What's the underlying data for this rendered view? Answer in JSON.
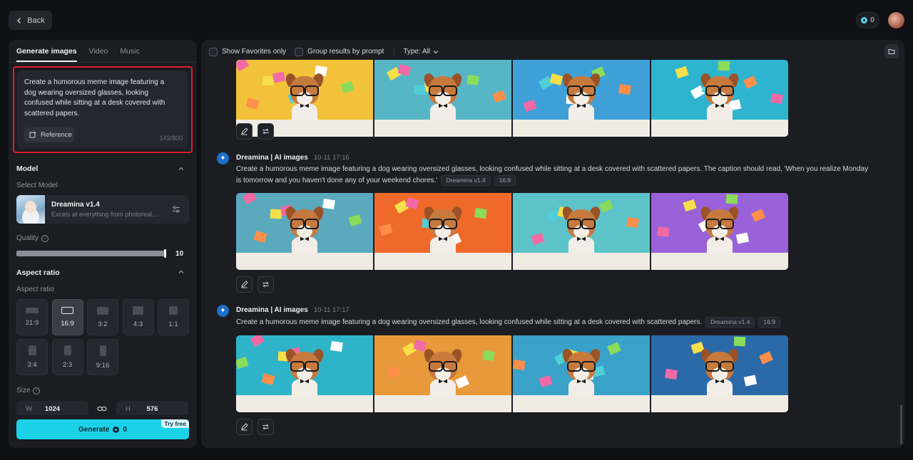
{
  "topbar": {
    "back_label": "Back",
    "credits": "0"
  },
  "left": {
    "tabs": [
      {
        "label": "Generate images",
        "active": true
      },
      {
        "label": "Video",
        "active": false
      },
      {
        "label": "Music",
        "active": false
      }
    ],
    "prompt": "Create a humorous meme image featuring a dog wearing oversized glasses, looking confused while sitting at a desk covered with scattered papers.",
    "reference_label": "Reference",
    "char_count": "143/800",
    "model": {
      "section_title": "Model",
      "select_label": "Select Model",
      "name": "Dreamina v1.4",
      "description": "Excels at everything from photorealism to painterly styles"
    },
    "quality": {
      "label": "Quality",
      "value": 10,
      "max": 10,
      "display": "10"
    },
    "aspect": {
      "section_title": "Aspect ratio",
      "sub_label": "Aspect ratio",
      "options": [
        {
          "label": "21:9",
          "active": false
        },
        {
          "label": "16:9",
          "active": true
        },
        {
          "label": "3:2",
          "active": false
        },
        {
          "label": "4:3",
          "active": false
        },
        {
          "label": "1:1",
          "active": false
        },
        {
          "label": "3:4",
          "active": false
        },
        {
          "label": "2:3",
          "active": false
        },
        {
          "label": "9:16",
          "active": false
        }
      ]
    },
    "size": {
      "label": "Size",
      "w_label": "W",
      "w_value": "1024",
      "h_label": "H",
      "h_value": "576"
    },
    "generate": {
      "label": "Generate",
      "cost": "0",
      "badge": "Try free"
    }
  },
  "right": {
    "filters": {
      "favorites": "Show Favorites only",
      "group": "Group results by prompt",
      "type": "Type: All"
    },
    "generations": [
      {
        "source": "",
        "time": "",
        "prompt": "",
        "tags": [],
        "palette": [
          "#f2c23a",
          "#57b6c6",
          "#3fa0d8",
          "#2fb4d0"
        ]
      },
      {
        "source": "Dreamina | AI images",
        "time": "10-11 17:16",
        "prompt": "Create a humorous meme image featuring a dog wearing oversized glasses, looking confused while sitting at a desk covered with scattered papers. The caption should read, 'When you realize Monday is tomorrow and you haven't done any of your weekend chores.'",
        "tags": [
          "Dreamina v1.4",
          "16:9"
        ],
        "palette": [
          "#5aa9bd",
          "#ef6a2a",
          "#5cc4c9",
          "#9a62d8"
        ]
      },
      {
        "source": "Dreamina | AI images",
        "time": "10-11 17:17",
        "prompt": "Create a humorous meme image featuring a dog wearing oversized glasses, looking confused while sitting at a desk covered with scattered papers.",
        "tags": [
          "Dreamina v1.4",
          "16:9"
        ],
        "palette": [
          "#2fb3c8",
          "#e89a3a",
          "#3aa1c8",
          "#2a6aa8"
        ]
      }
    ]
  },
  "colors": {
    "accent": "#1bd1e8",
    "highlight": "#e11d2a",
    "panel": "#1b1d23"
  }
}
